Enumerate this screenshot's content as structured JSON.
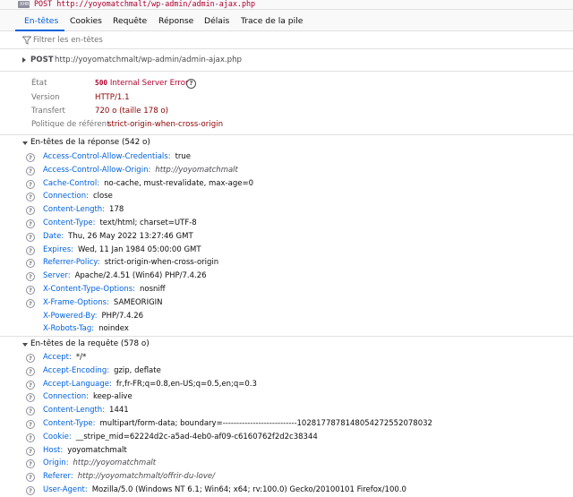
{
  "topbar": {
    "badge": "XHR",
    "url": "POST http://yoyomatchmalt/wp-admin/admin-ajax.php"
  },
  "tabs": [
    "En-têtes",
    "Cookies",
    "Requête",
    "Réponse",
    "Délais",
    "Trace de la pile"
  ],
  "filter": {
    "placeholder": "Filtrer les en-têtes"
  },
  "summary": {
    "method": "POST",
    "url": "http://yoyomatchmalt/wp-admin/admin-ajax.php"
  },
  "info": [
    {
      "label": "État",
      "code": "500",
      "value": "Internal Server Error"
    },
    {
      "label": "Version",
      "value": "HTTP/1.1"
    },
    {
      "label": "Transfert",
      "value": "720 o (taille 178 o)"
    },
    {
      "label": "Politique de référent",
      "value": "strict-origin-when-cross-origin"
    }
  ],
  "response_section": {
    "title": "En-têtes de la réponse (542 o)",
    "headers": [
      {
        "name": "Access-Control-Allow-Credentials:",
        "value": "true"
      },
      {
        "name": "Access-Control-Allow-Origin:",
        "value": "http://yoyomatchmalt",
        "italic": true
      },
      {
        "name": "Cache-Control:",
        "value": "no-cache, must-revalidate, max-age=0"
      },
      {
        "name": "Connection:",
        "value": "close"
      },
      {
        "name": "Content-Length:",
        "value": "178"
      },
      {
        "name": "Content-Type:",
        "value": "text/html; charset=UTF-8"
      },
      {
        "name": "Date:",
        "value": "Thu, 26 May 2022 13:27:46 GMT"
      },
      {
        "name": "Expires:",
        "value": "Wed, 11 Jan 1984 05:00:00 GMT"
      },
      {
        "name": "Referrer-Policy:",
        "value": "strict-origin-when-cross-origin"
      },
      {
        "name": "Server:",
        "value": "Apache/2.4.51 (Win64) PHP/7.4.26"
      },
      {
        "name": "X-Content-Type-Options:",
        "value": "nosniff"
      },
      {
        "name": "X-Frame-Options:",
        "value": "SAMEORIGIN"
      },
      {
        "name": "X-Powered-By:",
        "value": "PHP/7.4.26",
        "noicon": true
      },
      {
        "name": "X-Robots-Tag:",
        "value": "noindex",
        "noicon": true
      }
    ]
  },
  "request_section": {
    "title": "En-têtes de la requête (578 o)",
    "headers": [
      {
        "name": "Accept:",
        "value": "*/*"
      },
      {
        "name": "Accept-Encoding:",
        "value": "gzip, deflate"
      },
      {
        "name": "Accept-Language:",
        "value": "fr,fr-FR;q=0.8,en-US;q=0.5,en;q=0.3"
      },
      {
        "name": "Connection:",
        "value": "keep-alive"
      },
      {
        "name": "Content-Length:",
        "value": "1441"
      },
      {
        "name": "Content-Type:",
        "value": "multipart/form-data; boundary=---------------------------102817787814805427255207803​2"
      },
      {
        "name": "Cookie:",
        "value": "__stripe_mid=62224d2c-a5ad-4eb0-af09-c6160762f2d2c38344"
      },
      {
        "name": "Host:",
        "value": "yoyomatchmalt"
      },
      {
        "name": "Origin:",
        "value": "http://yoyomatchmalt",
        "italic": true
      },
      {
        "name": "Referer:",
        "value": "http://yoyomatchmalt/offrir-du-love/",
        "italic": true
      },
      {
        "name": "User-Agent:",
        "value": "Mozilla/5.0 (Windows NT 6.1; Win64; x64; rv:100.0) Gecko/20100101 Firefox/100.0"
      }
    ]
  }
}
